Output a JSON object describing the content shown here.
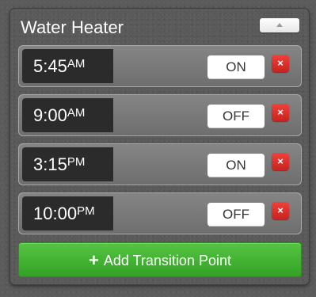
{
  "panel": {
    "title": "Water Heater"
  },
  "transitions": [
    {
      "time": "5:45",
      "period": "AM",
      "state": "ON"
    },
    {
      "time": "9:00",
      "period": "AM",
      "state": "OFF"
    },
    {
      "time": "3:15",
      "period": "PM",
      "state": "ON"
    },
    {
      "time": "10:00",
      "period": "PM",
      "state": "OFF"
    }
  ],
  "icons": {
    "delete": "×",
    "collapse": "caret-up-icon",
    "add": "+"
  },
  "add_button": {
    "label": "Add Transition Point"
  },
  "colors": {
    "accent_green": "#3bb02b",
    "delete_red": "#dc2f2a",
    "time_bg": "#2b2b2b"
  }
}
